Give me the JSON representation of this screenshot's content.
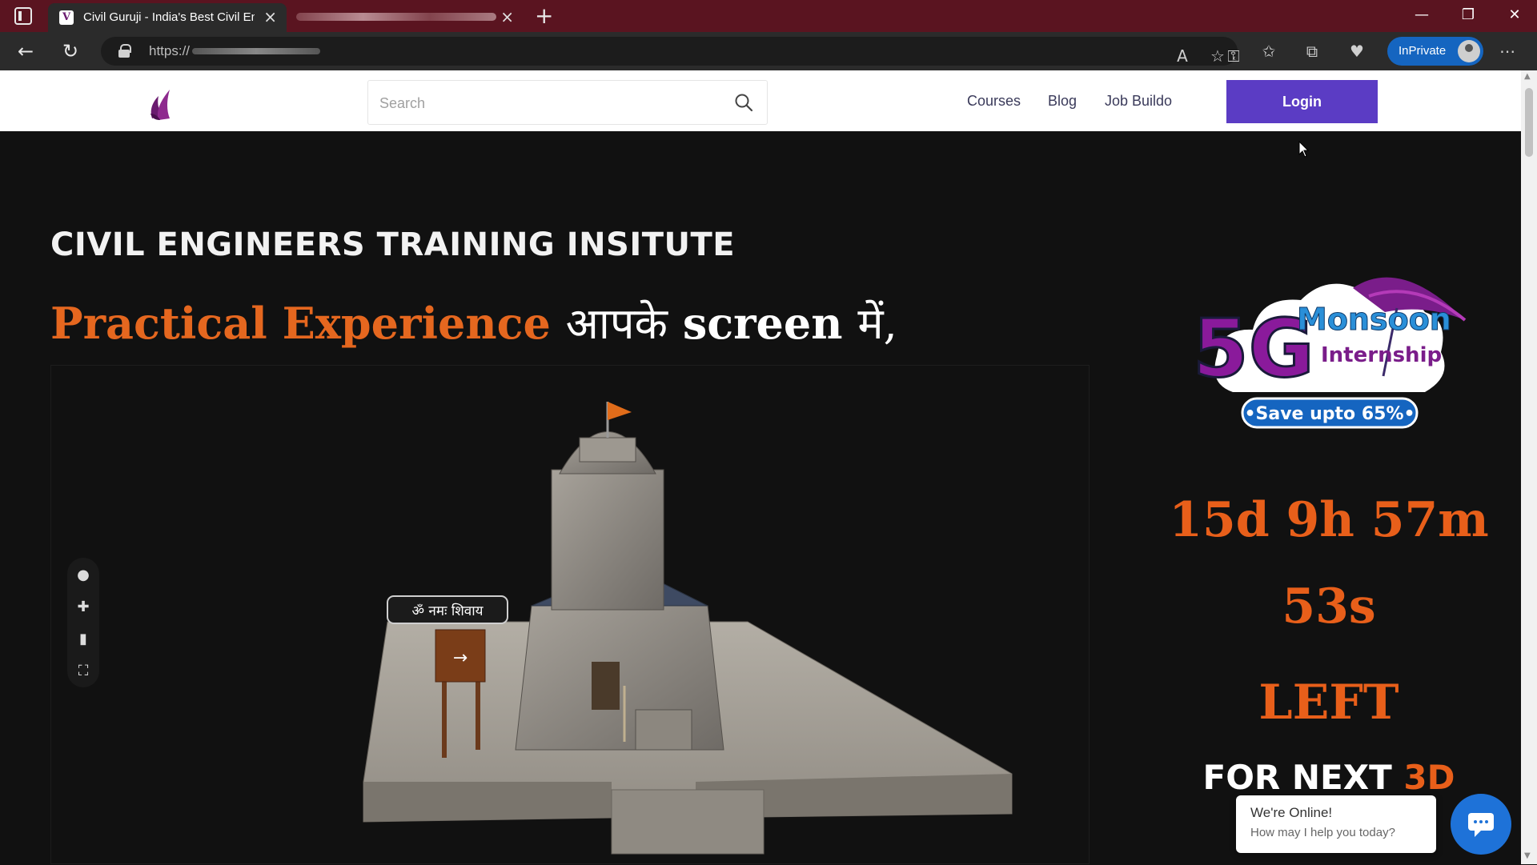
{
  "browser": {
    "active_tab_title": "Civil Guruji - India's Best Civil Eng",
    "tab_close": "×",
    "new_tab": "+",
    "url": "https://",
    "inprivate_label": "InPrivate",
    "window_minimize": "—",
    "window_restore": "❐",
    "window_close": "✕",
    "back": "←",
    "reload": "↻"
  },
  "header": {
    "search_placeholder": "Search",
    "nav": [
      "Courses",
      "Blog",
      "Job Buildo"
    ],
    "login_label": "Login"
  },
  "hero": {
    "heading": "CIVIL ENGINEERS TRAINING INSITUTE",
    "sub_orange": "Practical Experience",
    "sub_white_1": "आपके",
    "sub_white_2": "screen",
    "sub_white_3": "में,",
    "viewer_sign": "ॐ नमः शिवाय"
  },
  "promo": {
    "big": "5G",
    "monsoon": "Monsoon",
    "internship": "Internship",
    "save": "•Save upto 65%•",
    "countdown_1": "15d 9h 57m",
    "countdown_2": "53s",
    "countdown_3": "LEFT",
    "next_white": "FOR NEXT",
    "next_orange": "3D"
  },
  "chat": {
    "title": "We're Online!",
    "subtitle": "How may I help you today?"
  },
  "colors": {
    "tabbar": "#5a1420",
    "accent_login": "#5b3cc4",
    "orange": "#e5671f",
    "chat_blue": "#1e72d8"
  }
}
